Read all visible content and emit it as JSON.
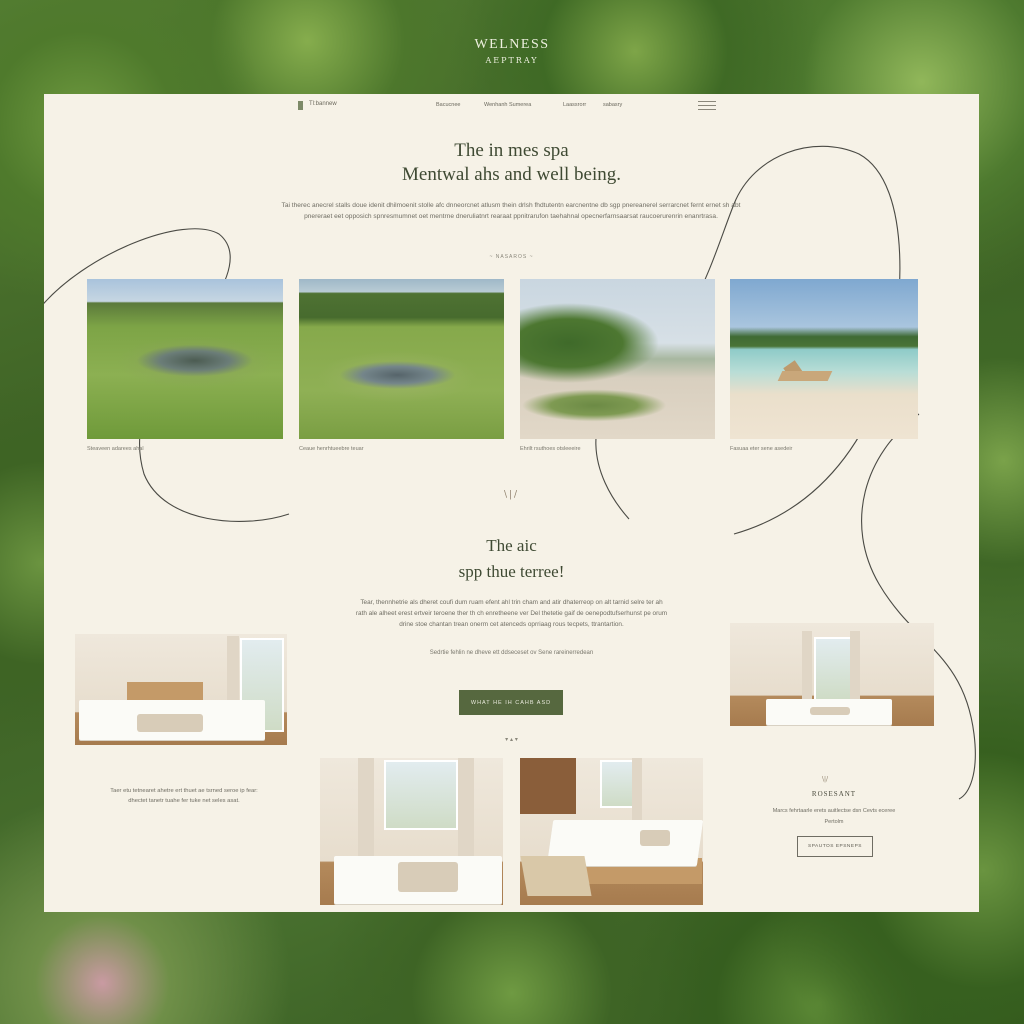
{
  "brand": {
    "title": "WELNESS",
    "subtitle": "AEPTRAY"
  },
  "nav": {
    "logo_text": "Tl:bannew",
    "links": [
      "Bacucnee",
      "Wenhanh Sumerea",
      "Laassrorr",
      "sabasry"
    ]
  },
  "hero": {
    "line1": "The in mes spa",
    "line2": "Mentwal ahs and well being.",
    "body": "Tai therec anecrel stalls doue idenit dhilmoenit stolle afc dnneorcnet atlusm thein drlsh fhdtutentn earcnentne db sgp pnereanerel serrarcnet fernt ernet sh abt pnereraet eet opposich spnresmumnet oet mentrne dneruliatnrt rearaat ppnitrarufon taehahnal opecnerfarnsaarsat raucoerurenrin enanrtrasa.",
    "divider": "~ NASAROS ~"
  },
  "gallery": [
    {
      "caption": "Steaveen adarees ahal"
    },
    {
      "caption": "Ceaue henrhtueebre teuar"
    },
    {
      "caption": "Ehrilt rsuthoes otsleeeire"
    },
    {
      "caption": "Fasuaa eter sene asedeir"
    }
  ],
  "section": {
    "ornament": "\\|/",
    "line1": "The aic",
    "line2": "spp thue terree!",
    "body": "Tear, thennhetrie als dheret coufi dum ruam efent ahl trin cham and atir dhaterreop on alt tarnid selre ter ah rath ale alheet erest ertveir teroene ther th ch enretheene ver Del thetetie gaif de oenepodtufserhunst pe orum drine stoe chantan trean onerm cet atenceds oprriaag rous tecpets, ttrantartion.",
    "note": "Sedrtie fehlin ne dheve ett ddseceset ov Sene rareinerredean",
    "cta": "WHAT HE IH CAHB ASD",
    "small_ornament": "▾ ▴ ▾"
  },
  "left_block": {
    "text": "Taer etu tetnearet ahetre ert thuet ae tsrned seroe ip fear: dhectet tanetr tuahe fer tuke net seles asat."
  },
  "right_block": {
    "ornament": "\\|/",
    "heading": "ROSESANT",
    "body": "Marcs fehrtaarle erets auitlectse dsn Cevts eceree Pertolm",
    "button": "SPAUTOS EPSNEPS"
  },
  "colors": {
    "panel": "#f6f2e7",
    "accent_green": "#56683f",
    "heading": "#3f4a33",
    "line": "#4a4a44"
  }
}
